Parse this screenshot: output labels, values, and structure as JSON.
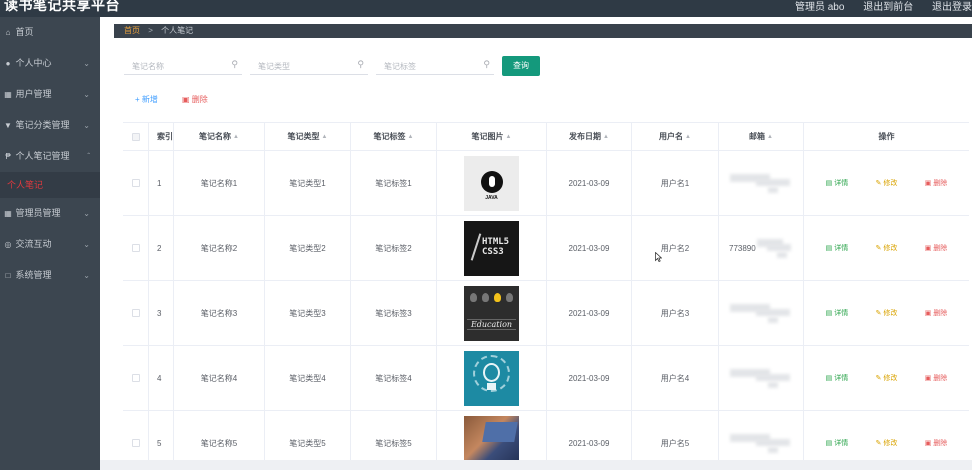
{
  "header": {
    "app_title": "读书笔记共享平台",
    "admin_label": "管理员 abo",
    "back_front": "退出到前台",
    "logout": "退出登录"
  },
  "sidebar": {
    "items": [
      {
        "label": "首页",
        "icon": "home-icon",
        "chevron": false
      },
      {
        "label": "个人中心",
        "icon": "user-icon",
        "chevron": true
      },
      {
        "label": "用户管理",
        "icon": "users-icon",
        "chevron": true
      },
      {
        "label": "笔记分类管理",
        "icon": "category-icon",
        "chevron": true
      },
      {
        "label": "个人笔记管理",
        "icon": "note-icon",
        "chevron": true,
        "expanded": true
      },
      {
        "label": "个人笔记",
        "sub": true
      },
      {
        "label": "管理员管理",
        "icon": "admin-icon",
        "chevron": true
      },
      {
        "label": "交流互动",
        "icon": "chat-icon",
        "chevron": true
      },
      {
        "label": "系统管理",
        "icon": "system-icon",
        "chevron": true
      }
    ]
  },
  "breadcrumb": {
    "home": "首页",
    "sep": ">",
    "current": "个人笔记"
  },
  "search": {
    "name_placeholder": "笔记名称",
    "type_placeholder": "笔记类型",
    "tag_placeholder": "笔记标签",
    "query_button": "查询"
  },
  "actions": {
    "add": "+ 新增",
    "delete": "删除"
  },
  "table": {
    "headers": {
      "index": "索引",
      "name": "笔记名称",
      "type": "笔记类型",
      "tag": "笔记标签",
      "image": "笔记图片",
      "date": "发布日期",
      "user": "用户名",
      "email": "邮箱",
      "ops": "操作"
    },
    "ops": {
      "detail": "详情",
      "edit": "修改",
      "delete": "删除"
    },
    "rows": [
      {
        "index": "1",
        "name": "笔记名称1",
        "type": "笔记类型1",
        "tag": "笔记标签1",
        "date": "2021-03-09",
        "user": "用户名1",
        "email": ""
      },
      {
        "index": "2",
        "name": "笔记名称2",
        "type": "笔记类型2",
        "tag": "笔记标签2",
        "date": "2021-03-09",
        "user": "用户名2",
        "email": "773890"
      },
      {
        "index": "3",
        "name": "笔记名称3",
        "type": "笔记类型3",
        "tag": "笔记标签3",
        "date": "2021-03-09",
        "user": "用户名3",
        "email": ""
      },
      {
        "index": "4",
        "name": "笔记名称4",
        "type": "笔记类型4",
        "tag": "笔记标签4",
        "date": "2021-03-09",
        "user": "用户名4",
        "email": ""
      },
      {
        "index": "5",
        "name": "笔记名称5",
        "type": "笔记类型5",
        "tag": "笔记标签5",
        "date": "2021-03-09",
        "user": "用户名5",
        "email": ""
      }
    ]
  },
  "thumb_texts": {
    "html": "HTML5",
    "css": "CSS3",
    "edu": "Education",
    "row1": "JAVA"
  },
  "colors": {
    "accent": "#14997c",
    "sidebar_bg": "#3c4650",
    "active_red": "#e0393e"
  }
}
